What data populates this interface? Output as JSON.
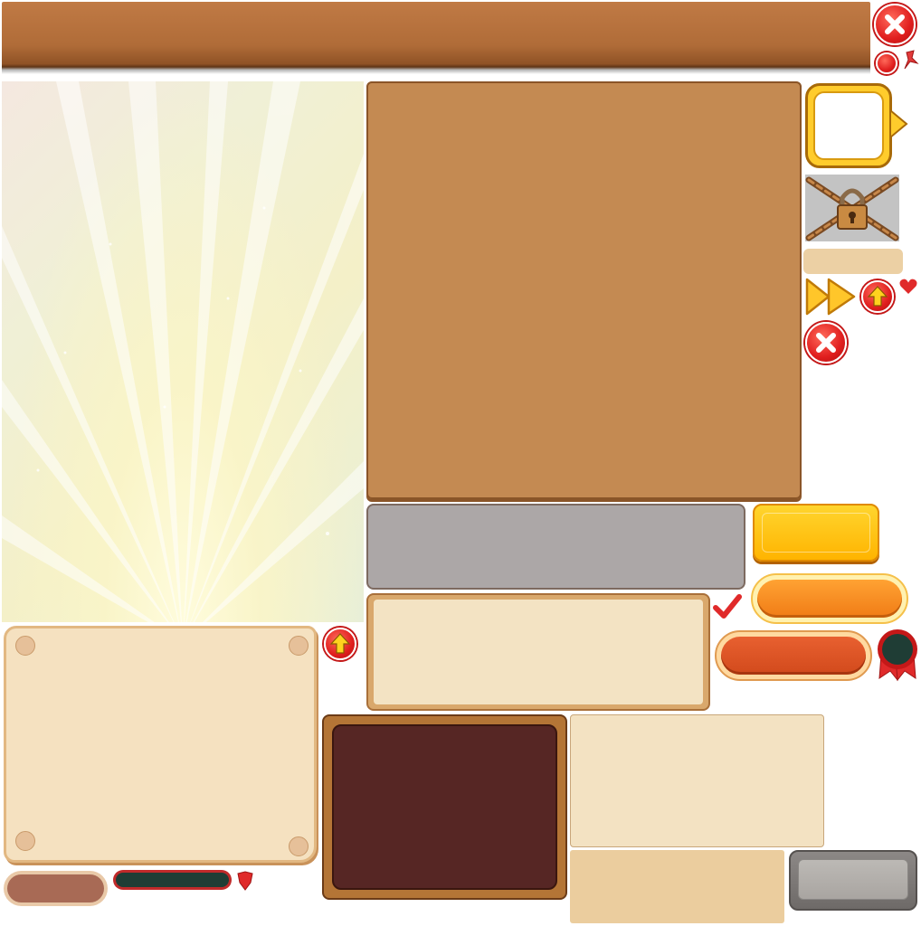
{
  "screen": {
    "type": "game-ui-sprite-atlas",
    "theme_colors": {
      "wood": "#b06c38",
      "dark_panel": "#5e332c",
      "cream": "#f3e3c3",
      "gold": "#ffcc2c",
      "orange": "#f07c16",
      "red": "#e01e1e"
    }
  },
  "icons": {
    "close_large": "close-icon",
    "close_small": "close-icon",
    "arrow_up": "arrow-up-icon",
    "heart": "heart-icon",
    "fast_forward": "fast-forward-icon",
    "checkmark": "check-icon",
    "lock": "padlock-icon",
    "badge": "ribbon-badge-icon",
    "shield": "shield-icon",
    "pin": "pin-icon"
  }
}
